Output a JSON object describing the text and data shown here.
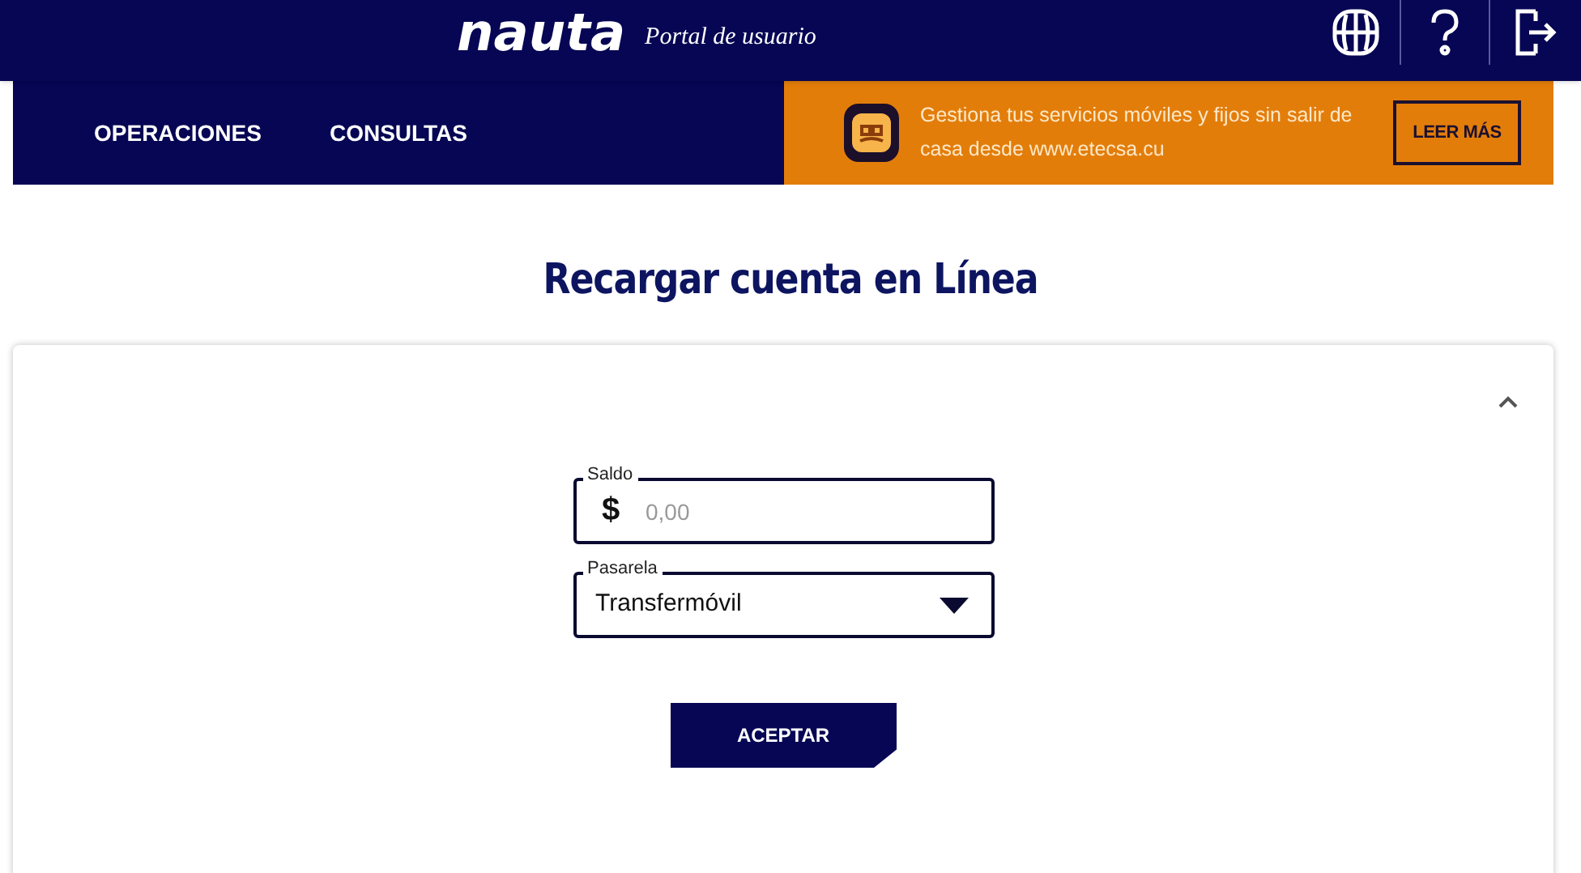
{
  "header": {
    "logo": "nauta",
    "subtitle": "Portal de usuario"
  },
  "nav": [
    {
      "label": "OPERACIONES"
    },
    {
      "label": "CONSULTAS"
    }
  ],
  "banner": {
    "text": "Gestiona tus servicios móviles y fijos sin salir de casa desde www.etecsa.cu",
    "button": "LEER MÁS"
  },
  "page_title": "Recargar cuenta en Línea",
  "card": {
    "expanded": true,
    "fields": [
      {
        "kind": "amount",
        "label": "Saldo",
        "prefix": "$",
        "placeholder": "0,00"
      },
      {
        "kind": "select",
        "label": "Pasarela",
        "value": "Transfermóvil"
      }
    ],
    "submit": "ACEPTAR"
  }
}
